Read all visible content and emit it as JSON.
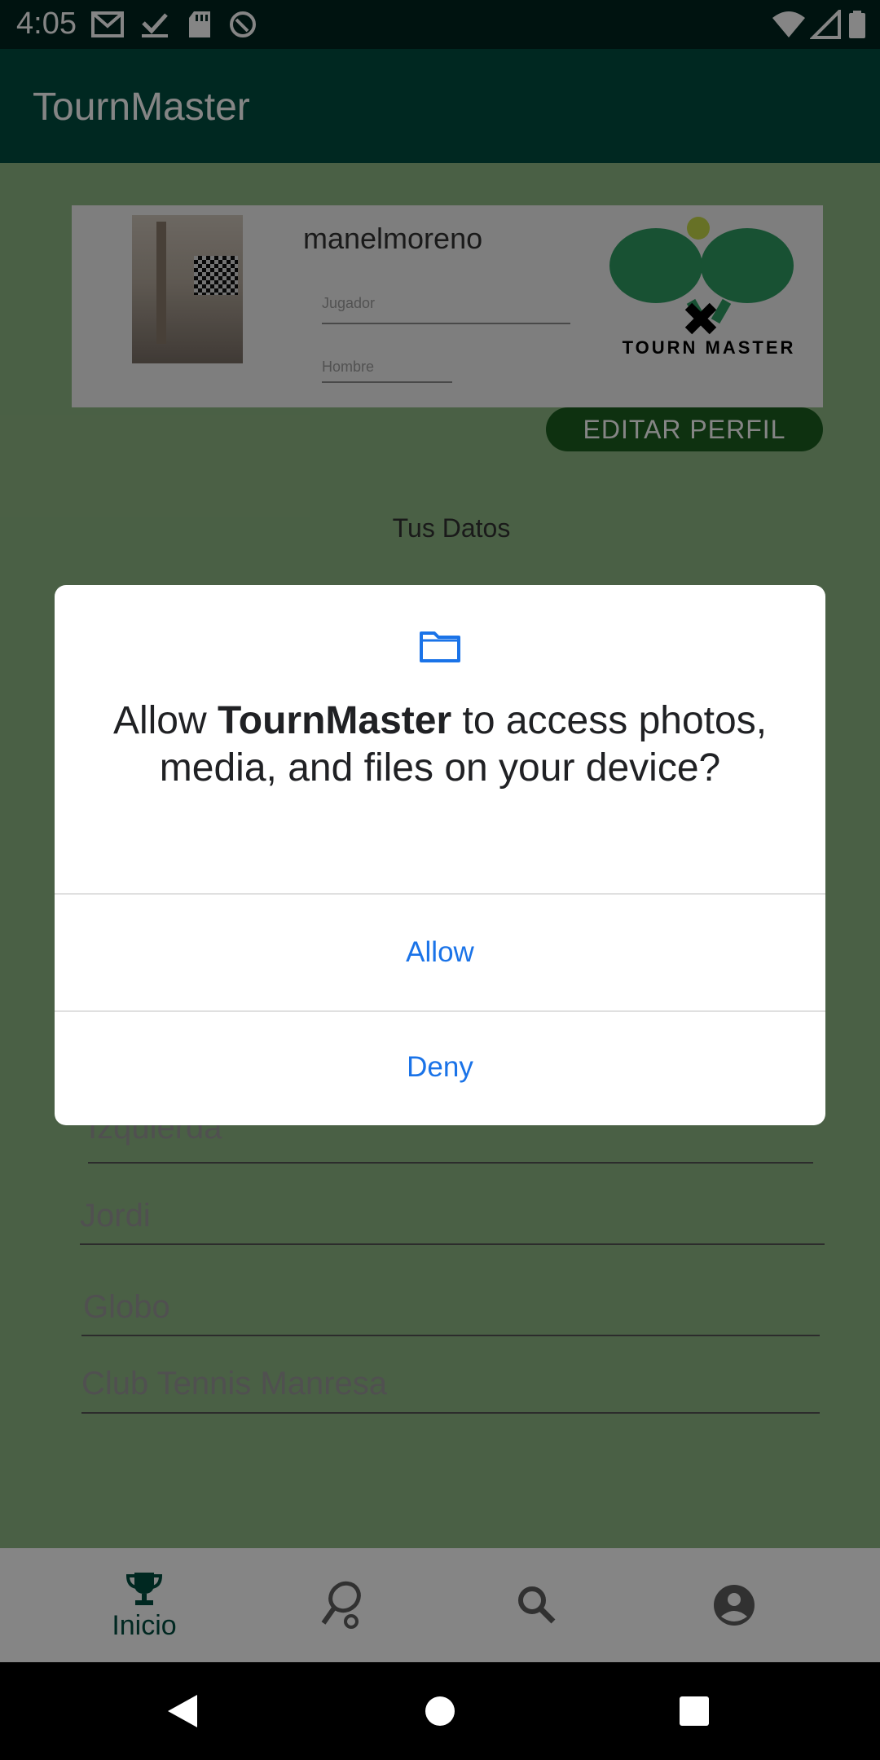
{
  "status_bar": {
    "time": "4:05"
  },
  "app_bar": {
    "title": "TournMaster"
  },
  "profile": {
    "username": "manelmoreno",
    "role_hint": "Jugador",
    "gender_hint": "Hombre",
    "logo_text": "TOURN MASTER",
    "edit_button": "EDITAR PERFIL"
  },
  "section_title": "Tus Datos",
  "data_fields": [
    "Izquierda",
    "Jordi",
    "Globo",
    "Club Tennis Manresa"
  ],
  "bottom_nav": {
    "items": [
      {
        "label": "Inicio",
        "icon": "trophy-icon",
        "active": true
      },
      {
        "label": "",
        "icon": "padel-racket-icon",
        "active": false
      },
      {
        "label": "",
        "icon": "search-icon",
        "active": false
      },
      {
        "label": "",
        "icon": "account-icon",
        "active": false
      }
    ]
  },
  "dialog": {
    "icon": "folder-icon",
    "message_prefix": "Allow ",
    "message_app": "TournMaster",
    "message_suffix": " to access photos, media, and files on your device?",
    "allow_label": "Allow",
    "deny_label": "Deny"
  },
  "colors": {
    "status_bar": "#00251f",
    "app_bar": "#004d40",
    "dialog_button": "#1a73e8",
    "edit_button": "#1b5e20"
  }
}
